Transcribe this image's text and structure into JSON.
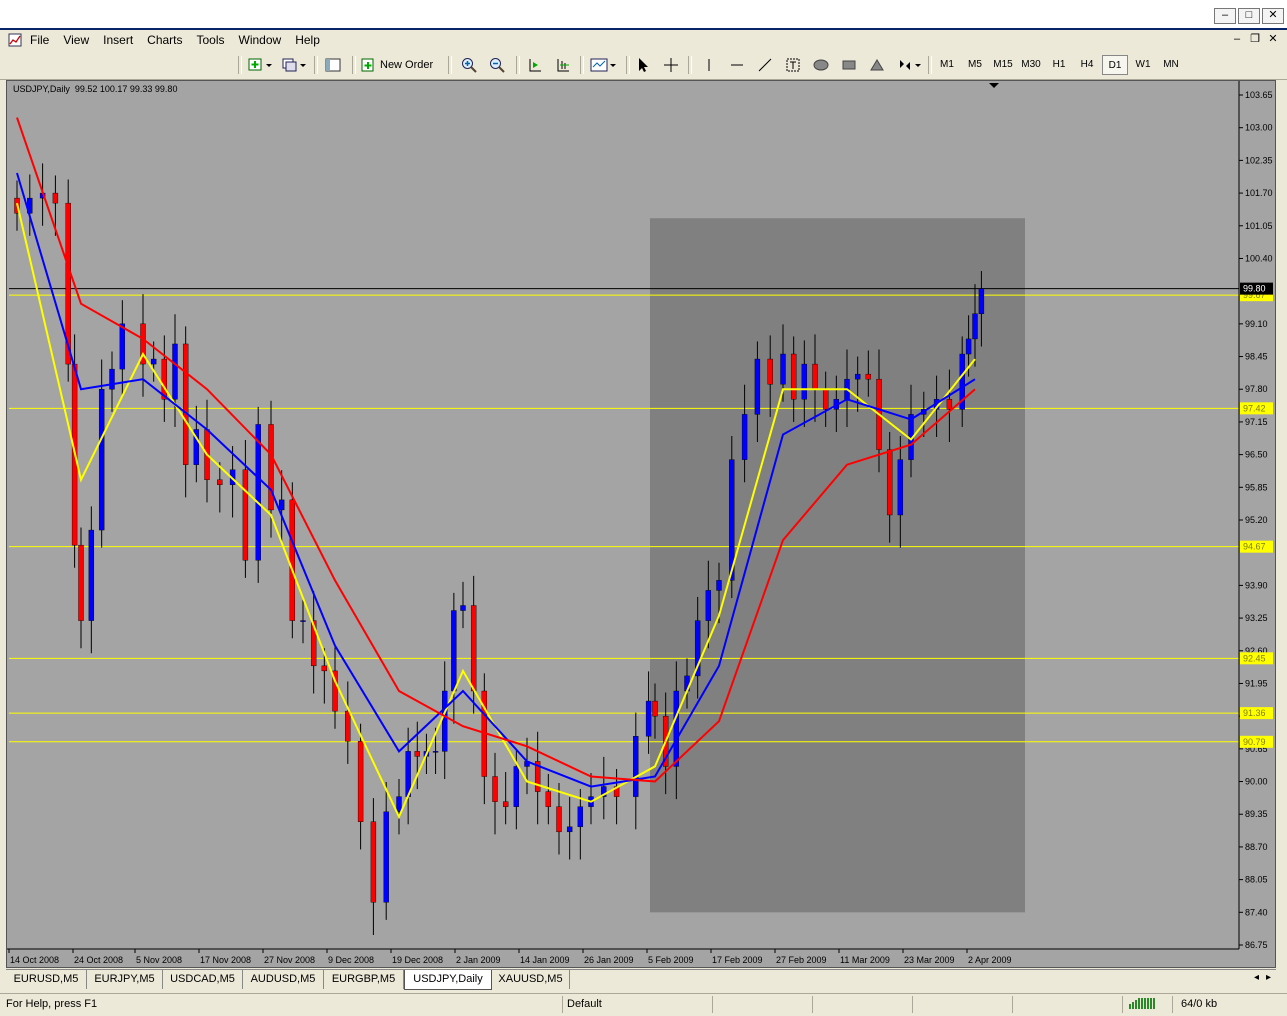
{
  "window": {
    "min_glyph": "–",
    "max_glyph": "□",
    "close_glyph": "✕"
  },
  "menu": {
    "items": [
      "File",
      "View",
      "Insert",
      "Charts",
      "Tools",
      "Window",
      "Help"
    ],
    "mdi_min": "–",
    "mdi_restore": "❐",
    "mdi_close": "✕"
  },
  "toolbar": {
    "new_order_label": "New Order",
    "timeframes": [
      "M1",
      "M5",
      "M15",
      "M30",
      "H1",
      "H4",
      "D1",
      "W1",
      "MN"
    ],
    "active_timeframe": "D1"
  },
  "chart": {
    "header": "USDJPY,Daily  99.52 100.17 99.33 99.80",
    "price_labels": [
      "103.65",
      "103.00",
      "102.35",
      "101.70",
      "101.05",
      "100.40",
      "99.10",
      "98.45",
      "97.80",
      "97.15",
      "96.50",
      "95.85",
      "95.20",
      "93.90",
      "93.25",
      "92.60",
      "91.95",
      "91.30",
      "90.65",
      "90.00",
      "89.35",
      "88.70",
      "88.05",
      "87.40",
      "86.75"
    ],
    "level_labels": [
      "99.67",
      "97.42",
      "94.67",
      "92.45",
      "91.36",
      "90.79"
    ],
    "current_price_label": "99.80",
    "date_labels": [
      "14 Oct 2008",
      "24 Oct 2008",
      "5 Nov 2008",
      "17 Nov 2008",
      "27 Nov 2008",
      "9 Dec 2008",
      "19 Dec 2008",
      "2 Jan 2009",
      "14 Jan 2009",
      "26 Jan 2009",
      "5 Feb 2009",
      "17 Feb 2009",
      "27 Feb 2009",
      "11 Mar 2009",
      "23 Mar 2009",
      "2 Apr 2009"
    ],
    "colors": {
      "background": "#a4a4a4",
      "highlight": "#808080",
      "bull": "#0000ff",
      "bear": "#ff0000",
      "wick": "#000000",
      "ma_fast": "#ffff00",
      "ma_mid": "#0000ff",
      "ma_slow": "#ff0000",
      "level": "#ffff00"
    }
  },
  "chart_data": {
    "type": "candlestick",
    "symbol": "USDJPY",
    "timeframe": "Daily",
    "ohlc_last": {
      "open": 99.52,
      "high": 100.17,
      "low": 99.33,
      "close": 99.8
    },
    "ylim": [
      86.75,
      103.65
    ],
    "horizontal_levels": [
      99.67,
      97.42,
      94.67,
      92.45,
      91.36,
      90.79
    ],
    "highlight_region": {
      "from": "5 Feb 2009",
      "to": "after 2 Apr 2009",
      "price_range": [
        87.4,
        101.2
      ]
    },
    "close_path": [
      {
        "date": "14 Oct 2008",
        "close": 101.3
      },
      {
        "date": "16 Oct 2008",
        "close": 101.6
      },
      {
        "date": "18 Oct 2008",
        "close": 101.7
      },
      {
        "date": "20 Oct 2008",
        "close": 101.5
      },
      {
        "date": "22 Oct 2008",
        "close": 98.3
      },
      {
        "date": "23 Oct 2008",
        "close": 94.7
      },
      {
        "date": "24 Oct 2008",
        "close": 93.2
      },
      {
        "date": "26 Oct 2008",
        "close": 95.0
      },
      {
        "date": "28 Oct 2008",
        "close": 97.8
      },
      {
        "date": "30 Oct 2008",
        "close": 98.2
      },
      {
        "date": "1 Nov 2008",
        "close": 99.1
      },
      {
        "date": "5 Nov 2008",
        "close": 98.3
      },
      {
        "date": "7 Nov 2008",
        "close": 98.4
      },
      {
        "date": "9 Nov 2008",
        "close": 97.6
      },
      {
        "date": "11 Nov 2008",
        "close": 98.7
      },
      {
        "date": "13 Nov 2008",
        "close": 96.3
      },
      {
        "date": "15 Nov 2008",
        "close": 97.0
      },
      {
        "date": "17 Nov 2008",
        "close": 96.0
      },
      {
        "date": "19 Nov 2008",
        "close": 95.9
      },
      {
        "date": "21 Nov 2008",
        "close": 96.2
      },
      {
        "date": "23 Nov 2008",
        "close": 94.4
      },
      {
        "date": "25 Nov 2008",
        "close": 97.1
      },
      {
        "date": "27 Nov 2008",
        "close": 95.4
      },
      {
        "date": "29 Nov 2008",
        "close": 95.6
      },
      {
        "date": "1 Dec 2008",
        "close": 93.2
      },
      {
        "date": "3 Dec 2008",
        "close": 93.2
      },
      {
        "date": "5 Dec 2008",
        "close": 92.3
      },
      {
        "date": "7 Dec 2008",
        "close": 92.2
      },
      {
        "date": "9 Dec 2008",
        "close": 91.4
      },
      {
        "date": "11 Dec 2008",
        "close": 90.8
      },
      {
        "date": "13 Dec 2008",
        "close": 89.2
      },
      {
        "date": "15 Dec 2008",
        "close": 87.6
      },
      {
        "date": "17 Dec 2008",
        "close": 89.4
      },
      {
        "date": "19 Dec 2008",
        "close": 89.7
      },
      {
        "date": "21 Dec 2008",
        "close": 90.6
      },
      {
        "date": "23 Dec 2008",
        "close": 90.5
      },
      {
        "date": "25 Dec 2008",
        "close": 90.6
      },
      {
        "date": "27 Dec 2008",
        "close": 90.6
      },
      {
        "date": "29 Dec 2008",
        "close": 91.8
      },
      {
        "date": "31 Dec 2008",
        "close": 93.4
      },
      {
        "date": "2 Jan 2009",
        "close": 93.5
      },
      {
        "date": "4 Jan 2009",
        "close": 91.8
      },
      {
        "date": "6 Jan 2009",
        "close": 90.1
      },
      {
        "date": "8 Jan 2009",
        "close": 89.6
      },
      {
        "date": "10 Jan 2009",
        "close": 89.5
      },
      {
        "date": "12 Jan 2009",
        "close": 90.3
      },
      {
        "date": "14 Jan 2009",
        "close": 90.4
      },
      {
        "date": "16 Jan 2009",
        "close": 89.8
      },
      {
        "date": "18 Jan 2009",
        "close": 89.5
      },
      {
        "date": "20 Jan 2009",
        "close": 89.0
      },
      {
        "date": "22 Jan 2009",
        "close": 89.1
      },
      {
        "date": "24 Jan 2009",
        "close": 89.5
      },
      {
        "date": "26 Jan 2009",
        "close": 89.7
      },
      {
        "date": "28 Jan 2009",
        "close": 89.9
      },
      {
        "date": "30 Jan 2009",
        "close": 89.7
      },
      {
        "date": "2 Feb 2009",
        "close": 90.9
      },
      {
        "date": "4 Feb 2009",
        "close": 91.6
      },
      {
        "date": "5 Feb 2009",
        "close": 91.3
      },
      {
        "date": "7 Feb 2009",
        "close": 90.3
      },
      {
        "date": "9 Feb 2009",
        "close": 91.8
      },
      {
        "date": "11 Feb 2009",
        "close": 92.1
      },
      {
        "date": "13 Feb 2009",
        "close": 93.2
      },
      {
        "date": "15 Feb 2009",
        "close": 93.8
      },
      {
        "date": "17 Feb 2009",
        "close": 94.0
      },
      {
        "date": "19 Feb 2009",
        "close": 96.4
      },
      {
        "date": "21 Feb 2009",
        "close": 97.3
      },
      {
        "date": "23 Feb 2009",
        "close": 98.4
      },
      {
        "date": "25 Feb 2009",
        "close": 97.9
      },
      {
        "date": "27 Feb 2009",
        "close": 98.5
      },
      {
        "date": "1 Mar 2009",
        "close": 97.6
      },
      {
        "date": "3 Mar 2009",
        "close": 98.3
      },
      {
        "date": "5 Mar 2009",
        "close": 97.8
      },
      {
        "date": "7 Mar 2009",
        "close": 97.4
      },
      {
        "date": "9 Mar 2009",
        "close": 97.6
      },
      {
        "date": "11 Mar 2009",
        "close": 98.0
      },
      {
        "date": "13 Mar 2009",
        "close": 98.1
      },
      {
        "date": "15 Mar 2009",
        "close": 98.0
      },
      {
        "date": "17 Mar 2009",
        "close": 96.6
      },
      {
        "date": "19 Mar 2009",
        "close": 95.3
      },
      {
        "date": "21 Mar 2009",
        "close": 96.4
      },
      {
        "date": "23 Mar 2009",
        "close": 97.3
      },
      {
        "date": "25 Mar 2009",
        "close": 97.4
      },
      {
        "date": "27 Mar 2009",
        "close": 97.6
      },
      {
        "date": "29 Mar 2009",
        "close": 97.4
      },
      {
        "date": "31 Mar 2009",
        "close": 98.5
      },
      {
        "date": "1 Apr 2009",
        "close": 98.8
      },
      {
        "date": "2 Apr 2009",
        "close": 99.3
      },
      {
        "date": "3 Apr 2009",
        "close": 99.8
      }
    ],
    "moving_averages": [
      {
        "color": "yellow",
        "path": [
          [
            "14 Oct 2008",
            101.5
          ],
          [
            "24 Oct 2008",
            96.0
          ],
          [
            "5 Nov 2008",
            98.5
          ],
          [
            "17 Nov 2008",
            96.5
          ],
          [
            "27 Nov 2008",
            95.3
          ],
          [
            "9 Dec 2008",
            92.0
          ],
          [
            "19 Dec 2008",
            89.3
          ],
          [
            "2 Jan 2009",
            92.2
          ],
          [
            "14 Jan 2009",
            90.0
          ],
          [
            "26 Jan 2009",
            89.6
          ],
          [
            "5 Feb 2009",
            90.3
          ],
          [
            "17 Feb 2009",
            93.3
          ],
          [
            "27 Feb 2009",
            97.8
          ],
          [
            "11 Mar 2009",
            97.8
          ],
          [
            "23 Mar 2009",
            96.8
          ],
          [
            "2 Apr 2009",
            98.4
          ]
        ]
      },
      {
        "color": "blue",
        "path": [
          [
            "14 Oct 2008",
            102.1
          ],
          [
            "24 Oct 2008",
            97.8
          ],
          [
            "5 Nov 2008",
            98.0
          ],
          [
            "17 Nov 2008",
            97.0
          ],
          [
            "27 Nov 2008",
            95.8
          ],
          [
            "9 Dec 2008",
            92.7
          ],
          [
            "19 Dec 2008",
            90.6
          ],
          [
            "2 Jan 2009",
            91.8
          ],
          [
            "14 Jan 2009",
            90.4
          ],
          [
            "26 Jan 2009",
            89.9
          ],
          [
            "5 Feb 2009",
            90.1
          ],
          [
            "17 Feb 2009",
            92.3
          ],
          [
            "27 Feb 2009",
            96.9
          ],
          [
            "11 Mar 2009",
            97.6
          ],
          [
            "23 Mar 2009",
            97.2
          ],
          [
            "2 Apr 2009",
            98.0
          ]
        ]
      },
      {
        "color": "red",
        "path": [
          [
            "14 Oct 2008",
            103.2
          ],
          [
            "24 Oct 2008",
            99.5
          ],
          [
            "5 Nov 2008",
            98.8
          ],
          [
            "17 Nov 2008",
            97.8
          ],
          [
            "27 Nov 2008",
            96.5
          ],
          [
            "9 Dec 2008",
            94.0
          ],
          [
            "19 Dec 2008",
            91.8
          ],
          [
            "2 Jan 2009",
            91.1
          ],
          [
            "14 Jan 2009",
            90.7
          ],
          [
            "26 Jan 2009",
            90.1
          ],
          [
            "5 Feb 2009",
            90.0
          ],
          [
            "17 Feb 2009",
            91.2
          ],
          [
            "27 Feb 2009",
            94.8
          ],
          [
            "11 Mar 2009",
            96.3
          ],
          [
            "23 Mar 2009",
            96.7
          ],
          [
            "2 Apr 2009",
            97.8
          ]
        ]
      }
    ],
    "ylabel": "",
    "xlabel": ""
  },
  "tabs": {
    "items": [
      "EURUSD,M5",
      "EURJPY,M5",
      "USDCAD,M5",
      "AUDUSD,M5",
      "EURGBP,M5",
      "USDJPY,Daily",
      "XAUUSD,M5"
    ],
    "active": "USDJPY,Daily"
  },
  "status": {
    "help_text": "For Help, press F1",
    "profile": "Default",
    "traffic": "64/0 kb"
  }
}
